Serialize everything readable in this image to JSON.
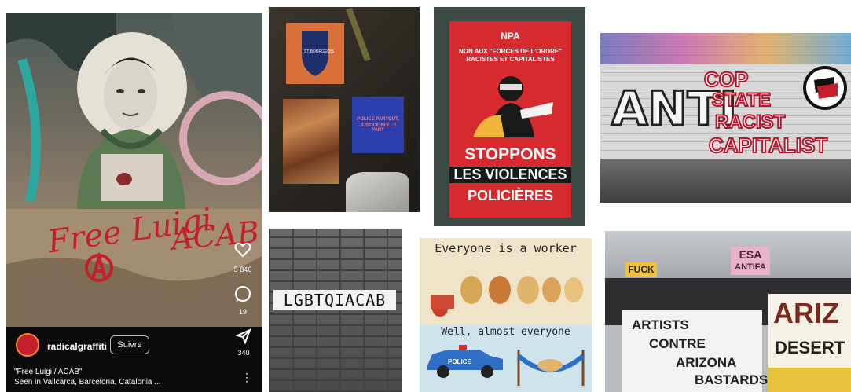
{
  "instagram_post": {
    "username": "radicalgraffiti",
    "follow_label": "Suivre",
    "like_count": "5 846",
    "comment_count": "19",
    "share_count": "340",
    "caption_line1": "\"Free Luigi / ACAB\"",
    "caption_line2": "Seen in Vallcarca, Barcelona, Catalonia ...",
    "graffiti_text1": "Free Luigi",
    "graffiti_text2": "ACAB"
  },
  "sticker_wall": {
    "blue_sticker_text1": "POLICE PARTOUT,",
    "blue_sticker_text2": "JUSTICE NULLE PART",
    "orange_sticker_text": "ST BOURGEOIS"
  },
  "npa_poster": {
    "party": "NPA",
    "subtitle1": "NON AUX \"FORCES DE L'ORDRE\"",
    "subtitle2": "RACISTES ET CAPITALISTES",
    "line1": "STOPPONS",
    "line2": "LES VIOLENCES",
    "line3": "POLICIÈRES"
  },
  "mural": {
    "word_anti": "ANTI",
    "word_cop": "COP",
    "word_state": "STATE",
    "word_racist": "RACIST",
    "word_capitalist": "CAPITALIST"
  },
  "brick_sign": {
    "text": "LGBTQIACAB"
  },
  "cartoon": {
    "title": "Everyone is a worker",
    "subtitle": "Well, almost everyone",
    "car_label": "POLICE"
  },
  "protest": {
    "sign1": "ESA",
    "sign2": "ANTIFA",
    "sign3": "FUCK",
    "banner_line1": "ARTISTS",
    "banner_line2": "CONTRE",
    "banner_line3": "ARIZONA",
    "banner_line4": "BASTARDS",
    "banner2_line1": "ARIZ",
    "banner2_line2": "DESERT"
  },
  "colors": {
    "graffiti_red": "#c4202a",
    "npa_red": "#d62a2f",
    "blue_sticker": "#2d3fae",
    "orange_sticker": "#d9703a",
    "instagram_bar": "#0b0b0b"
  }
}
